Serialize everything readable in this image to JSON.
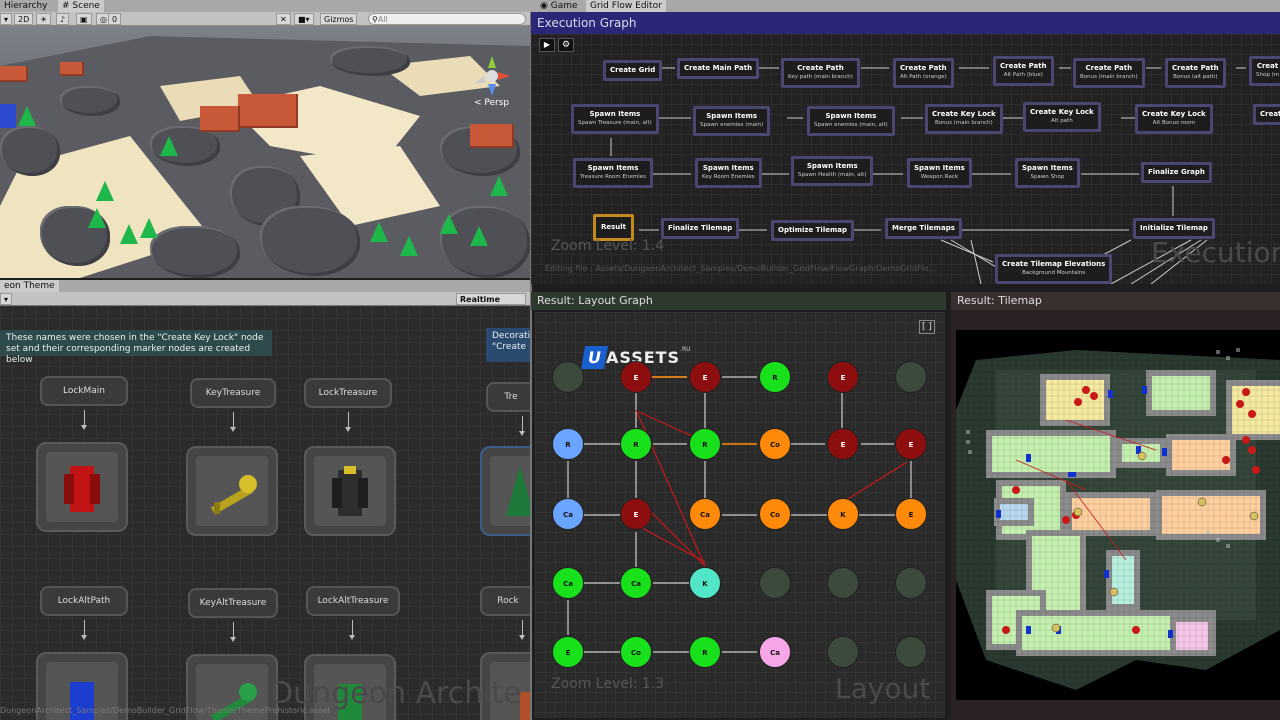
{
  "tabs": {
    "hierarchy": "Hierarchy",
    "scene": "Scene",
    "game": "Game",
    "grid_flow_editor": "Grid Flow Editor"
  },
  "scene_toolbar": {
    "mode_2d": "2D",
    "badge_count": "0",
    "gizmos": "Gizmos",
    "search_placeholder": "All",
    "persp": "< Persp"
  },
  "theme": {
    "tab": "eon Theme",
    "realtime_update": "Realtime Update",
    "note_text_1": "These names were chosen in the \"Create Key Lock\" node",
    "note_text_2": "set and their corresponding marker nodes are created below",
    "deco_text_1": "Decorati",
    "deco_text_2": "\"Create",
    "markers_row1": [
      "LockMain",
      "KeyTreasure",
      "LockTreasure",
      "Tre"
    ],
    "markers_row2": [
      "LockAltPath",
      "KeyAltTreasure",
      "LockAltTreasure",
      "Rock"
    ],
    "footer_path": "DungeonArchitect_Samples/DemoBuilder_GridFlow/Theme/ThemePrehistoric.asset",
    "watermark": "Dungeon Archite"
  },
  "exec": {
    "header": "Execution Graph",
    "zoom": "Zoom Level: 1.4",
    "editing": "Editing file : Assets/DungeonArchitect_Samples/DemoBuilder_GridFlow/FlowGraph/DemoGridFlo...",
    "watermark": "Execution",
    "nodes": [
      {
        "id": "n1",
        "title": "Create Grid",
        "sub": ""
      },
      {
        "id": "n2",
        "title": "Create Main Path",
        "sub": ""
      },
      {
        "id": "n3",
        "title": "Create Path",
        "sub": "Key path (main branch)"
      },
      {
        "id": "n4",
        "title": "Create Path",
        "sub": "Alt Path (orange)"
      },
      {
        "id": "n5",
        "title": "Create Path",
        "sub": "Alt Path (blue)"
      },
      {
        "id": "n6",
        "title": "Create Path",
        "sub": "Bonus (main branch)"
      },
      {
        "id": "n7",
        "title": "Create Path",
        "sub": "Bonus (alt path)"
      },
      {
        "id": "n8",
        "title": "Creat",
        "sub": "Shop (m"
      },
      {
        "id": "n9",
        "title": "Spawn Items",
        "sub": "Spawn Treasure (main, alt)"
      },
      {
        "id": "n10",
        "title": "Spawn Items",
        "sub": "Spawn enemies (main)"
      },
      {
        "id": "n11",
        "title": "Spawn Items",
        "sub": "Spawn enemies (main, alt)"
      },
      {
        "id": "n12",
        "title": "Create Key Lock",
        "sub": "Bonus (main branch)"
      },
      {
        "id": "n13",
        "title": "Create Key Lock",
        "sub": "Alt path"
      },
      {
        "id": "n14",
        "title": "Create Key Lock",
        "sub": "Alt Bonus room"
      },
      {
        "id": "n15",
        "title": "Creat",
        "sub": ""
      },
      {
        "id": "n16",
        "title": "Spawn Items",
        "sub": "Treasure Room Enemies"
      },
      {
        "id": "n17",
        "title": "Spawn Items",
        "sub": "Key Room Enemies"
      },
      {
        "id": "n18",
        "title": "Spawn Items",
        "sub": "Spawn Health (main, alt)"
      },
      {
        "id": "n19",
        "title": "Spawn Items",
        "sub": "Weapon Rack"
      },
      {
        "id": "n20",
        "title": "Spawn Items",
        "sub": "Spawn Shop"
      },
      {
        "id": "n21",
        "title": "Finalize Graph",
        "sub": ""
      },
      {
        "id": "n22",
        "title": "Result",
        "sub": ""
      },
      {
        "id": "n23",
        "title": "Finalize Tilemap",
        "sub": ""
      },
      {
        "id": "n24",
        "title": "Optimize Tilemap",
        "sub": ""
      },
      {
        "id": "n25",
        "title": "Merge Tilemaps",
        "sub": ""
      },
      {
        "id": "n26",
        "title": "Initialize Tilemap",
        "sub": ""
      },
      {
        "id": "n27",
        "title": "Create Tilemap Elevations",
        "sub": "Background Mountains"
      }
    ]
  },
  "layout": {
    "header": "Result: Layout Graph",
    "zoom": "Zoom Level: 1.3",
    "watermark": "Layout",
    "logo_u": "U",
    "logo_assets": "ASSETS",
    "logo_ru": ".RU"
  },
  "tilemap": {
    "header": "Result: Tilemap"
  },
  "colors": {
    "exec_header": "#2a2778",
    "room_green": "#18e01a",
    "room_orange": "#ff8a0a",
    "room_blue": "#6aa6ff",
    "room_dark_red": "#8c0e0e",
    "room_cyan": "#52e6c8",
    "room_pink": "#f7a6e8",
    "room_empty": "#3c4a3c"
  }
}
